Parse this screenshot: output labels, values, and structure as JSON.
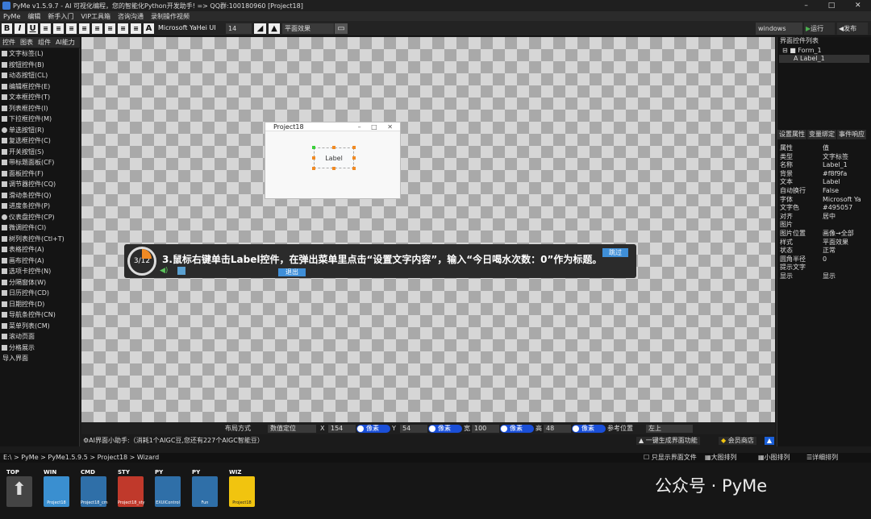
{
  "window": {
    "title": "PyMe v1.5.9.7 - AI 可视化编程，您的智能化Python开发助手!  => QQ群:100180960   [Project18]",
    "min": "–",
    "max": "□",
    "close": "✕"
  },
  "menu": [
    "PyMe",
    "编辑",
    "新手入门",
    "VIP工具箱",
    "咨询沟通",
    "录制操作视频"
  ],
  "toolbar": {
    "bold": "B",
    "italic": "I",
    "underline": "U",
    "a_big": "A",
    "font_name": "Microsoft YaHei UI",
    "font_size": "14",
    "effect": "平面效果",
    "platform": "windows",
    "run": "运行",
    "publish": "发布"
  },
  "left_tabs": [
    "控件",
    "图表",
    "组件",
    "AI能力"
  ],
  "controls": [
    "文字标签(L)",
    "按钮控件(B)",
    "动态按钮(CL)",
    "编辑框控件(E)",
    "文本框控件(T)",
    "列表框控件(I)",
    "下拉框控件(M)",
    "单选按钮(R)",
    "复选框控件(C)",
    "开关按钮(S)",
    "带标题面板(CF)",
    "面板控件(F)",
    "调节器控件(CQ)",
    "滑动条控件(Q)",
    "进度条控件(P)",
    "仪表盘控件(CP)",
    "微调控件(CI)",
    "树列表控件(Ctl+T)",
    "表格控件(A)",
    "画布控件(A)",
    "选项卡控件(N)",
    "分隔窗体(W)",
    "日历控件(CD)",
    "日期控件(D)",
    "导航条控件(CN)",
    "菜单列表(CM)",
    "滚动页面",
    "分格展示",
    "导入界面"
  ],
  "form": {
    "title": "Project18",
    "label_text": "Label",
    "btns": "–  □  ✕"
  },
  "tip": {
    "progress": "3/12",
    "text": "3.鼠标右键单击Label控件，在弹出菜单里点击“设置文字内容”，输入“今日喝水次数：0”作为标题。",
    "skip": "跳过",
    "exit": "退出"
  },
  "right": {
    "title": "界面控件列表",
    "tree_form": "Form_1",
    "tree_label": "Label_1",
    "tabs": [
      "设置属性",
      "变量绑定",
      "事件响应"
    ],
    "prop_header": [
      "属性",
      "值"
    ],
    "props": [
      [
        "类型",
        "文字标签"
      ],
      [
        "名称",
        "Label_1"
      ],
      [
        "背景",
        "#f8f9fa"
      ],
      [
        "文本",
        "Label"
      ],
      [
        "自动换行",
        "False"
      ],
      [
        "字体",
        "Microsoft Ya"
      ],
      [
        "文字色",
        "#495057"
      ],
      [
        "对齐",
        "居中"
      ],
      [
        "图片",
        ""
      ],
      [
        "图片位置",
        "画像→全部"
      ],
      [
        "样式",
        "平面效果"
      ],
      [
        "状态",
        "正常"
      ],
      [
        "圆角半径",
        "0"
      ],
      [
        "提示文字",
        ""
      ],
      [
        "显示",
        "显示"
      ]
    ]
  },
  "posbar": {
    "layout_label": "布局方式",
    "layout_value": "数值定位",
    "x_label": "X",
    "x_value": "154",
    "x_unit": "像素",
    "y_label": "Y",
    "y_value": "54",
    "y_unit": "像素",
    "w_label": "宽",
    "w_value": "100",
    "w_unit": "像素",
    "h_label": "高",
    "h_value": "48",
    "h_unit": "像素",
    "ref_label": "参考位置",
    "ref_value": "左上"
  },
  "status": {
    "assistant": "AI界面小助手:（消耗1个AIGC豆,您还有227个AIGC智能豆）",
    "gen": "一键生成界面功能",
    "shop": "会员商店"
  },
  "path": "E:\\ > PyMe > PyMe1.5.9.5 > Project18 > Wizard",
  "view_options": [
    "只显示界面文件",
    "大图排列",
    "小图排列",
    "详细排列"
  ],
  "files": [
    {
      "tag": "TOP",
      "name": "",
      "color": "#444444"
    },
    {
      "tag": "WIN",
      "name": "Project18",
      "color": "#3a8fd0"
    },
    {
      "tag": "CMD",
      "name": "Project18_cm",
      "color": "#2f6fa8"
    },
    {
      "tag": "STY",
      "name": "Project18_sty",
      "color": "#c0392b"
    },
    {
      "tag": "PY",
      "name": "EXUIControl",
      "color": "#2f6fa8"
    },
    {
      "tag": "PY",
      "name": "Fun",
      "color": "#2f6fa8"
    },
    {
      "tag": "WIZ",
      "name": "Project18",
      "color": "#f1c40f"
    }
  ],
  "watermark": "公众号 · PyMe"
}
